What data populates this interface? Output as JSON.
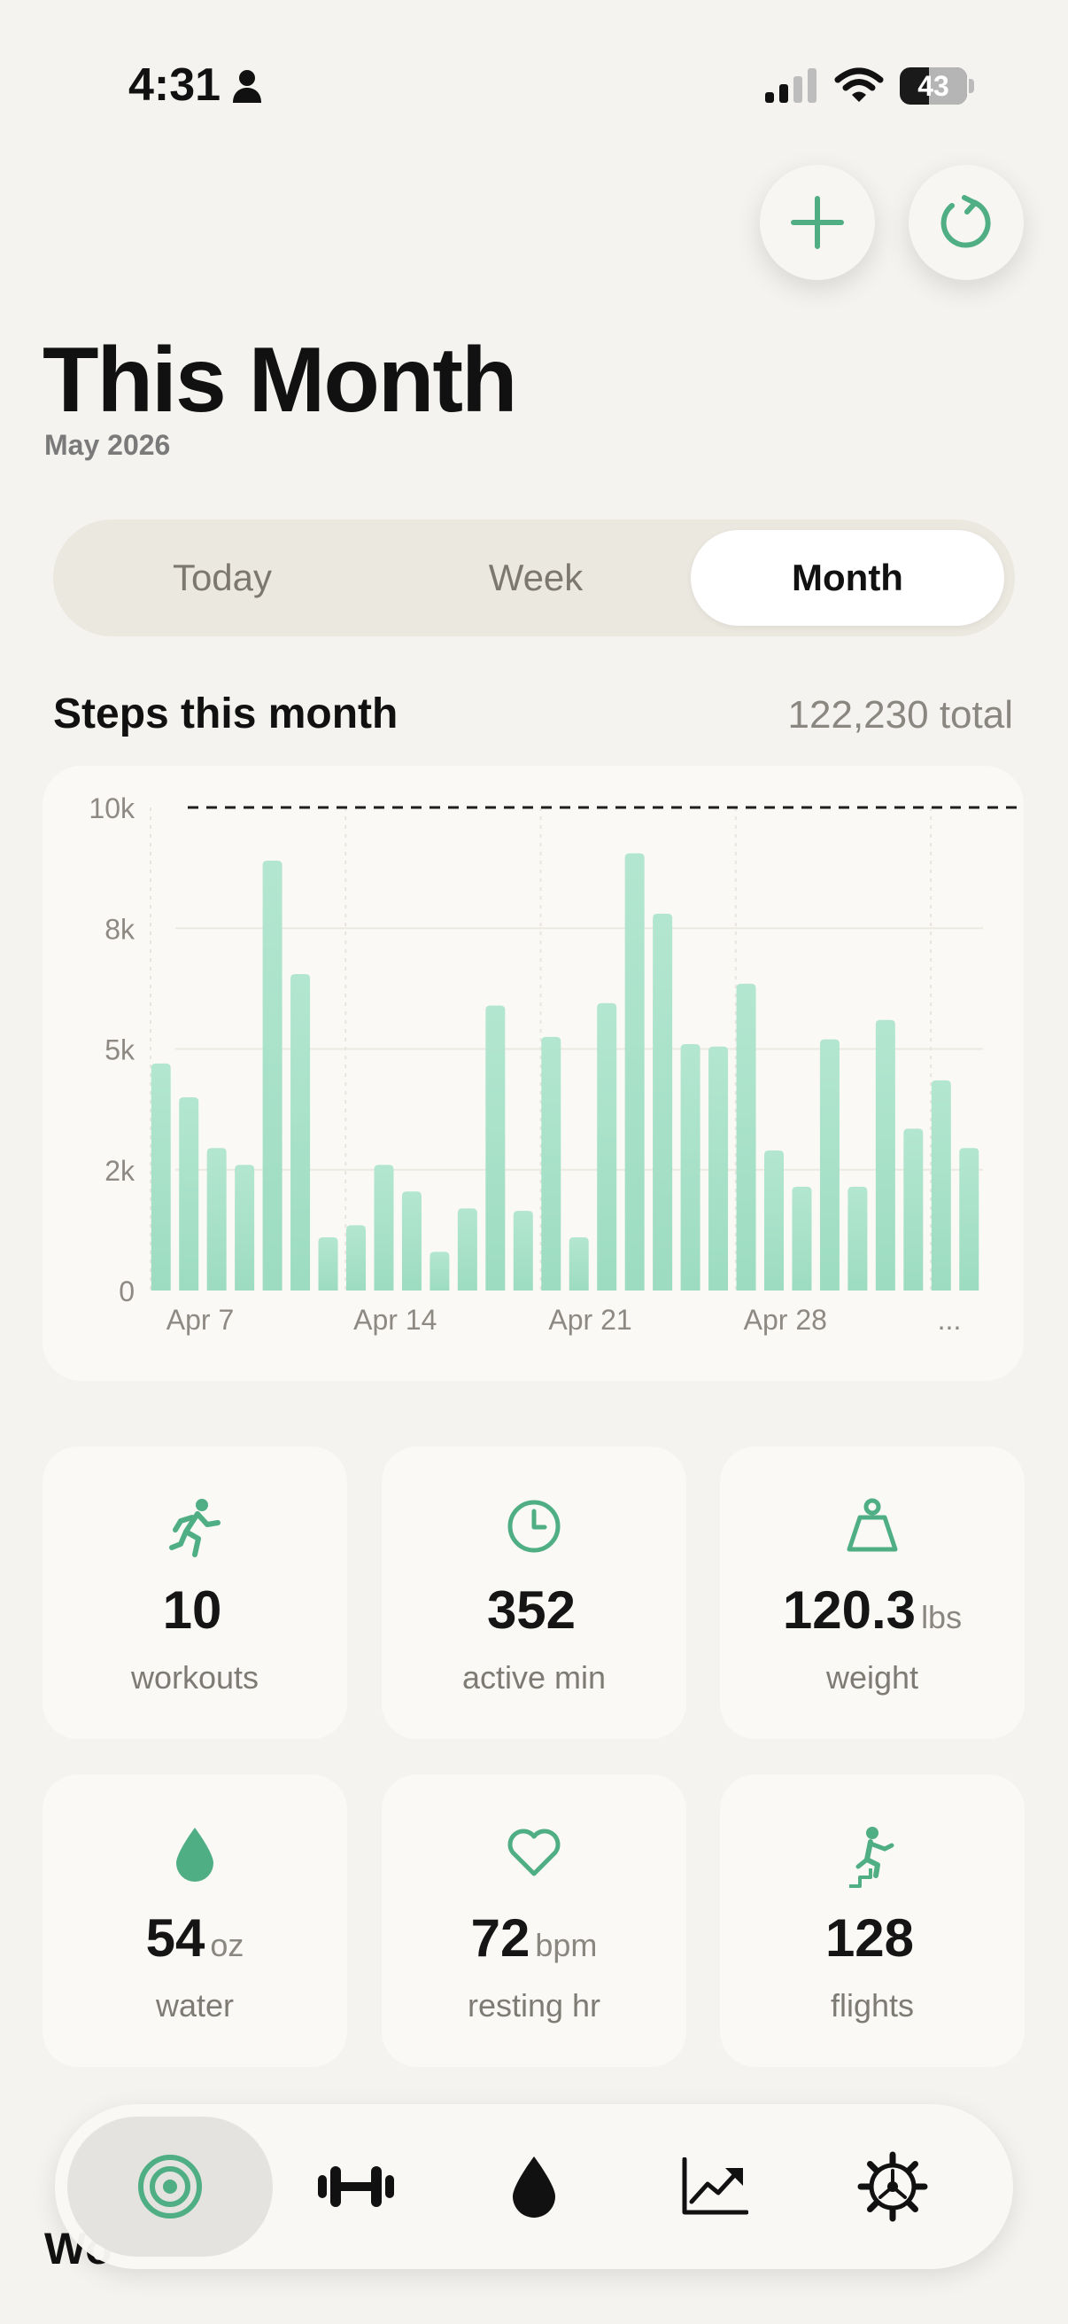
{
  "status_bar": {
    "time": "4:31",
    "battery": "43",
    "icons": [
      "person-icon",
      "signal-icon",
      "wifi-icon",
      "battery-icon"
    ]
  },
  "actions": {
    "add_icon": "plus-icon",
    "refresh_icon": "refresh-icon",
    "accent": "#4fae84"
  },
  "header": {
    "title": "This Month",
    "subtitle": "May 2026"
  },
  "segments": {
    "options": [
      "Today",
      "Week",
      "Month"
    ],
    "selected": "Month"
  },
  "steps": {
    "title": "Steps this month",
    "total": "122,230 total"
  },
  "chart_data": {
    "type": "bar",
    "title": "",
    "xlabel": "",
    "ylabel": "",
    "ylim": [
      0,
      10000
    ],
    "goal_line": 10000,
    "ytick_labels": [
      "10k",
      "8k",
      "5k",
      "2k",
      "0"
    ],
    "xtick_labels": [
      "Apr 7",
      "Apr 14",
      "Apr 21",
      "Apr 28",
      "..."
    ],
    "grid": true,
    "bar_color": "#9ddcc1",
    "values": [
      4700,
      4000,
      2950,
      2600,
      8900,
      6550,
      1100,
      1350,
      2600,
      2050,
      800,
      1700,
      5900,
      1650,
      5250,
      1100,
      5950,
      9050,
      7800,
      5100,
      5050,
      6350,
      2900,
      2150,
      5200,
      2150,
      5600,
      3350,
      4350,
      2950
    ]
  },
  "stats": [
    {
      "icon": "running-icon",
      "value": "10",
      "unit": "",
      "label": "workouts"
    },
    {
      "icon": "clock-icon",
      "value": "352",
      "unit": "",
      "label": "active min"
    },
    {
      "icon": "scale-weight-icon",
      "value": "120.3",
      "unit": "lbs",
      "label": "weight"
    },
    {
      "icon": "water-drop-icon",
      "value": "54",
      "unit": "oz",
      "label": "water"
    },
    {
      "icon": "heart-icon",
      "value": "72",
      "unit": "bpm",
      "label": "resting hr"
    },
    {
      "icon": "stairs-climber-icon",
      "value": "128",
      "unit": "",
      "label": "flights"
    }
  ],
  "peek": {
    "text": "Wo"
  },
  "tab_bar": {
    "items": [
      {
        "icon": "target-icon",
        "active": true
      },
      {
        "icon": "dumbbell-icon",
        "active": false
      },
      {
        "icon": "drop-icon",
        "active": false
      },
      {
        "icon": "trend-chart-icon",
        "active": false
      },
      {
        "icon": "settings-gear-icon",
        "active": false
      }
    ]
  }
}
